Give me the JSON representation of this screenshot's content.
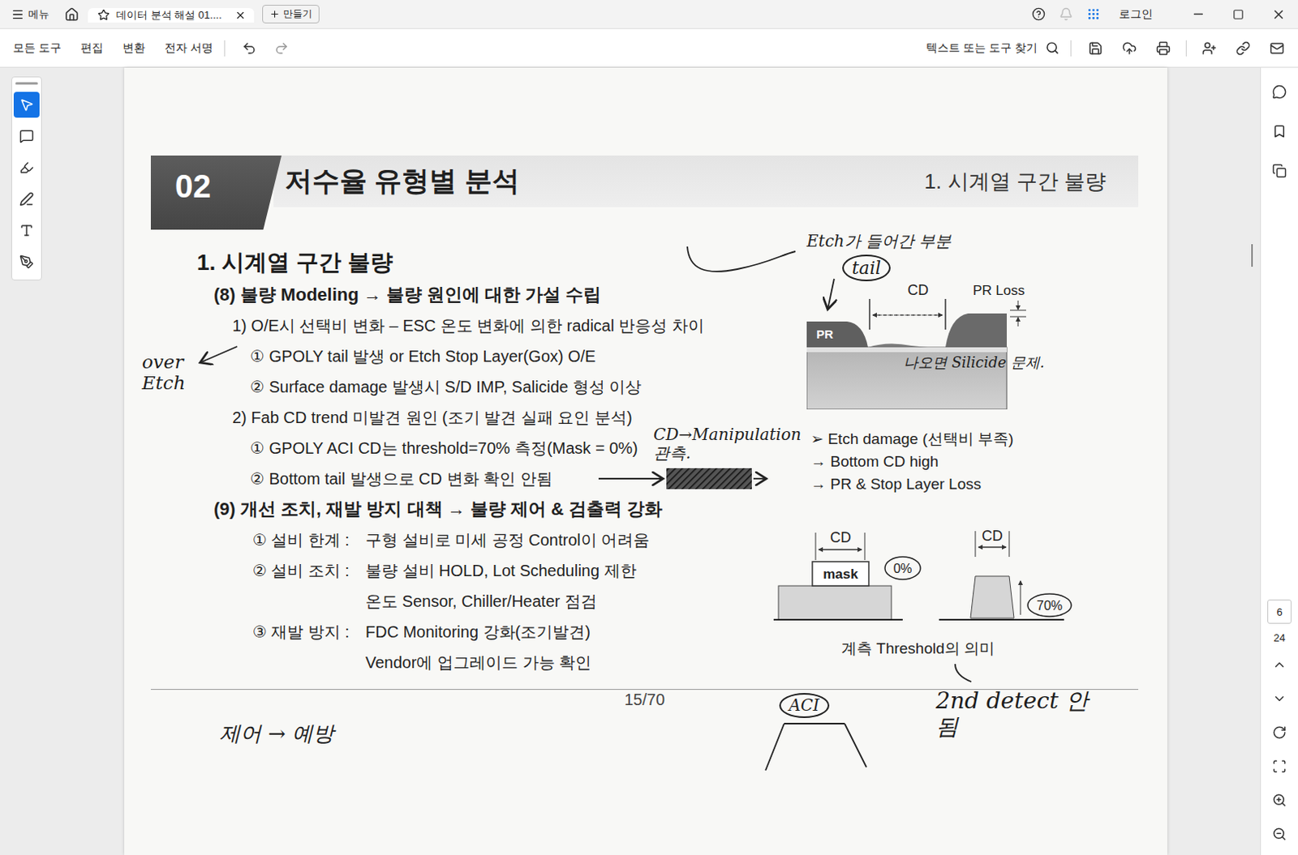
{
  "window": {
    "title": "데이터 분석 해설 01...."
  },
  "top_bar": {
    "menu": "메뉴",
    "new_button": "만들기",
    "login": "로그인"
  },
  "toolbar": {
    "items": [
      "모든 도구",
      "편집",
      "변환",
      "전자 서명"
    ],
    "search_placeholder": "텍스트 또는 도구 찾기"
  },
  "tools": [
    {
      "kind": "select",
      "selected": true
    },
    {
      "kind": "comment",
      "selected": false
    },
    {
      "kind": "highlight",
      "selected": false
    },
    {
      "kind": "draw",
      "selected": false
    },
    {
      "kind": "text",
      "selected": false
    },
    {
      "kind": "sign",
      "selected": false
    }
  ],
  "page_nav": {
    "current": "6",
    "total": "24"
  },
  "document": {
    "banner": {
      "number": "02",
      "title": "저수율 유형별 분석",
      "section": "1. 시계열 구간 불량"
    },
    "heading": "1. 시계열 구간 불량",
    "lines": [
      {
        "kind": "sub",
        "text": "(8) 불량 Modeling → 불량 원인에 대한 가설 수립"
      },
      {
        "kind": "point",
        "text": "1) O/E시 선택비 변화 – ESC 온도 변화에 의한 radical 반응성 차이"
      },
      {
        "kind": "item",
        "text": "① GPOLY tail 발생 or Etch Stop Layer(Gox) O/E"
      },
      {
        "kind": "item",
        "text": "② Surface damage 발생시 S/D IMP, Salicide 형성 이상"
      },
      {
        "kind": "point",
        "text": "2) Fab CD trend 미발견 원인 (조기 발견 실패 요인 분석)"
      },
      {
        "kind": "item",
        "text": "① GPOLY ACI CD는 threshold=70% 측정(Mask = 0%)"
      },
      {
        "kind": "item",
        "text": "② Bottom tail 발생으로 CD 변화 확인 안됨"
      },
      {
        "kind": "sub",
        "text": "(9) 개선 조치, 재발 방지 대책 → 불량 제어 & 검출력 강화"
      },
      {
        "kind": "labeled",
        "label": "① 설비 한계 :",
        "text": "구형 설비로 미세 공정 Control이 어려움"
      },
      {
        "kind": "labeled",
        "label": "② 설비 조치 :",
        "text": "불량 설비 HOLD, Lot Scheduling 제한"
      },
      {
        "kind": "cont",
        "text": "온도 Sensor, Chiller/Heater 점검"
      },
      {
        "kind": "labeled",
        "label": "③ 재발 방지 :",
        "text": "FDC Monitoring 강화(조기발견)"
      },
      {
        "kind": "cont",
        "text": "Vendor에 업그레이드 가능 확인"
      }
    ],
    "figure_1": {
      "cd": "CD",
      "pr_loss": "PR Loss",
      "pr": "PR",
      "notes": [
        "➢ Etch damage (선택비 부족)",
        "→ Bottom CD high",
        "→ PR & Stop Layer Loss"
      ]
    },
    "figure_2": {
      "left": {
        "cd": "CD",
        "mask": "mask",
        "threshold": "0%"
      },
      "right": {
        "cd": "CD",
        "threshold": "70%"
      },
      "caption": "계측 Threshold의 의미"
    },
    "page_number": "15/70",
    "annotations": [
      {
        "text": "over Etch",
        "circled": false
      },
      {
        "text": "Etch가 들어간 부분",
        "circled": false
      },
      {
        "text": "tail",
        "circled": true
      },
      {
        "text": "CD→Manipulation 관측.",
        "circled": false
      },
      {
        "text": "나오면 Silicide 문제.",
        "circled": false
      },
      {
        "text": "제어 → 예방",
        "circled": false
      },
      {
        "text": "ACI",
        "circled": true
      },
      {
        "text": "2nd detect 안됨",
        "circled": false
      }
    ]
  }
}
